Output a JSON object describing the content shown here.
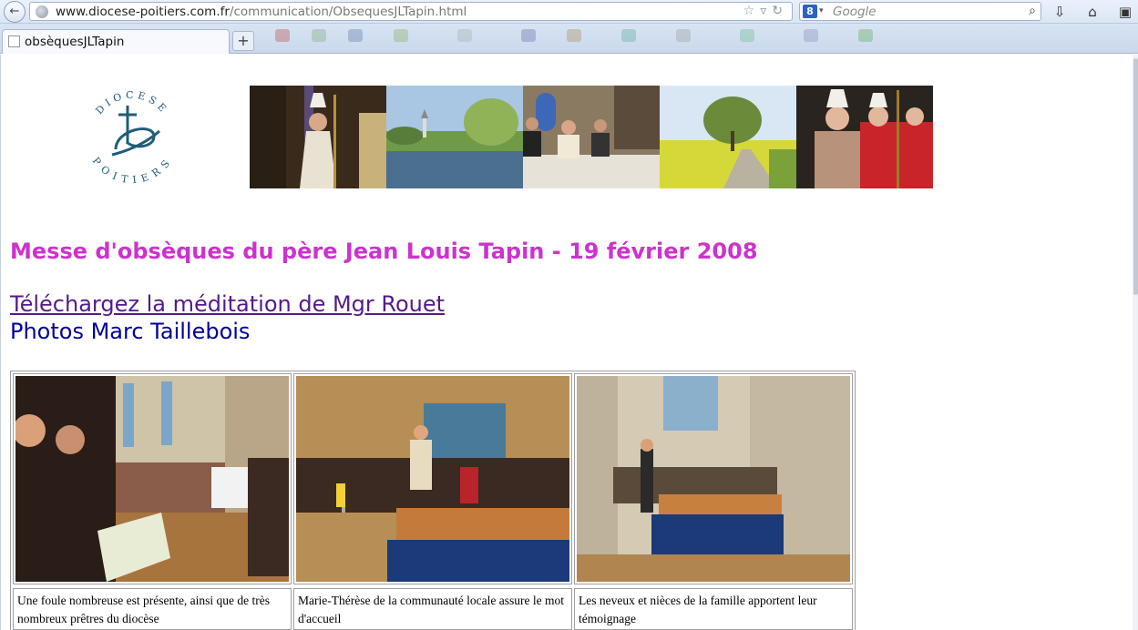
{
  "browser": {
    "url_domain": "www.diocese-poitiers.com.fr",
    "url_path": "/communication/ObsequesJLTapin.html",
    "search_placeholder": "Google",
    "search_engine_icon": "g-icon",
    "tab_title": "obsèquesJLTapin",
    "new_tab_label": "+"
  },
  "logo": {
    "text_top": "DIOCESE",
    "text_bottom": "POITIERS",
    "color": "#1f5d7a"
  },
  "banner": {
    "photos": [
      "bishop-with-crosier-photo",
      "river-and-village-photo",
      "altar-priests-photo",
      "country-road-photo",
      "bishops-red-robes-photo"
    ]
  },
  "content": {
    "title": "Messe d'obsèques du père Jean Louis Tapin - 19 février 2008",
    "download_link": "Téléchargez la méditation de Mgr Rouet",
    "credit": "Photos Marc Taillebois"
  },
  "photos": [
    {
      "name": "congregation-photo",
      "caption": "Une foule nombreuse est présente, ainsi que de très nombreux prêtres du diocèse"
    },
    {
      "name": "welcome-speech-photo",
      "caption": "Marie-Thérèse de la communauté locale assure le mot d'accueil"
    },
    {
      "name": "family-testimony-photo",
      "caption": "Les neveux et nièces de la famille apportent leur témoignage"
    }
  ],
  "colors": {
    "title": "#cc33cc",
    "link_visited": "#551a8b",
    "credit": "#000099"
  }
}
